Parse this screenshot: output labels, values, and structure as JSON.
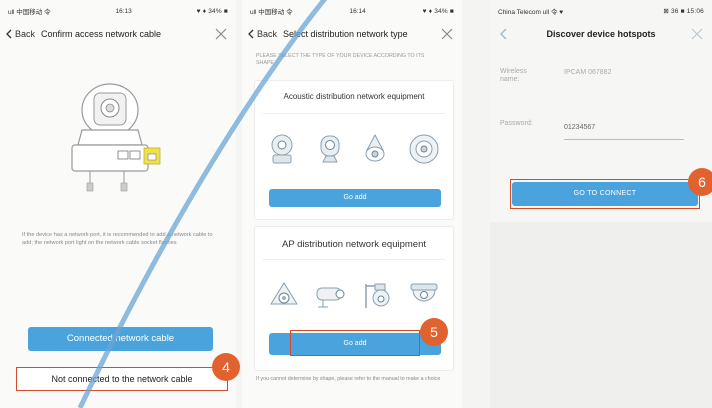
{
  "screen1": {
    "status_carrier": "ull 中国移动 令",
    "status_time": "16:13",
    "status_right": "♥ ♦ 34% ■",
    "back_label": "Back",
    "title": "Confirm access network cable",
    "hint": "If the device has a network port, it is recommended to add a network cable to add; the network port light on the network cable socket flashes",
    "connected_button": "Connected network cable",
    "not_connected_button": "Not connected to the network cable",
    "step_badge": "4"
  },
  "screen2": {
    "status_carrier": "ull 中国移动 令",
    "status_time": "16:14",
    "status_right": "♥ ♦ 34% ■",
    "back_label": "Back",
    "title": "Select distribution network type",
    "caption": "PLEASE SELECT THE TYPE OF YOUR DEVICE ACCORDING TO ITS SHAPE",
    "acoustic_title": "Acoustic distribution network equipment",
    "acoustic_button": "Go add",
    "ap_title": "AP distribution network equipment",
    "ap_button": "Go add",
    "hint": "If you cannot determine by shape, please refer to the manual to make a choice",
    "step_badge": "5"
  },
  "screen3": {
    "status_carrier": "China Telecom ull 令 ♥",
    "status_right": "⊠ 36 ■ 15:06",
    "title": "Discover device hotspots",
    "wireless_label": "Wireless name:",
    "wireless_value": "IPCAM 067882",
    "password_label": "Password:",
    "password_value": "01234567",
    "connect_button": "GO TO CONNECT",
    "step_badge": "6"
  },
  "colors": {
    "accent_blue": "#4ba3dd",
    "highlight_red": "#d24b2a",
    "badge_orange": "#e2622f"
  }
}
